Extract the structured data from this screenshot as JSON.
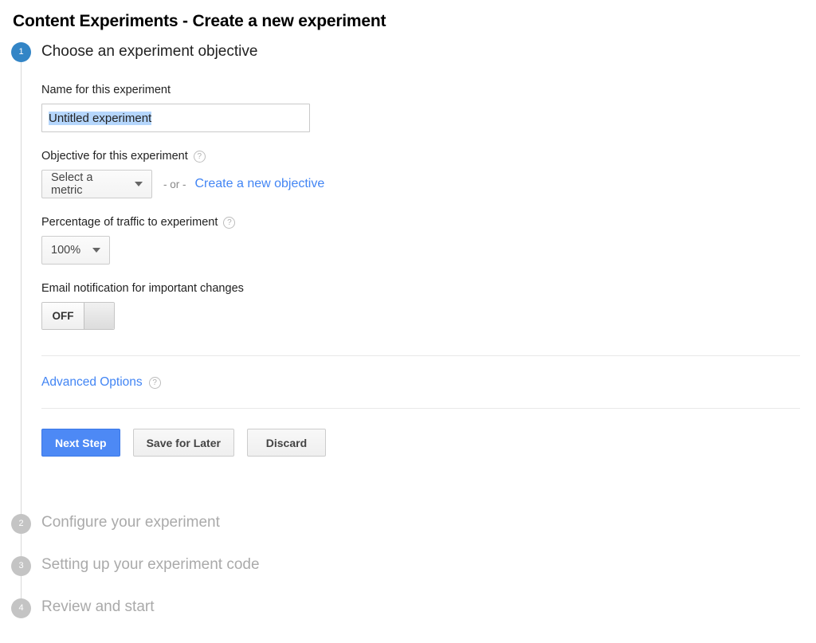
{
  "page": {
    "title": "Content Experiments - Create a new experiment"
  },
  "steps": [
    {
      "number": "1",
      "title": "Choose an experiment objective",
      "state": "active"
    },
    {
      "number": "2",
      "title": "Configure your experiment",
      "state": "inactive"
    },
    {
      "number": "3",
      "title": "Setting up your experiment code",
      "state": "inactive"
    },
    {
      "number": "4",
      "title": "Review and start",
      "state": "inactive"
    }
  ],
  "form": {
    "name_field": {
      "label": "Name for this experiment",
      "value": "Untitled experiment",
      "placeholder": "Untitled experiment"
    },
    "objective_field": {
      "label": "Objective for this experiment",
      "help_icon": "help-circle-icon",
      "dropdown_value": "Select a metric",
      "or_text": "- or -",
      "create_link": "Create a new objective"
    },
    "traffic_field": {
      "label": "Percentage of traffic to experiment",
      "help_icon": "help-circle-icon",
      "dropdown_value": "100%"
    },
    "email_field": {
      "label": "Email notification for important changes",
      "toggle_state": "OFF"
    },
    "advanced": {
      "label": "Advanced Options",
      "help_icon": "help-circle-icon"
    },
    "buttons": {
      "next": "Next Step",
      "save": "Save for Later",
      "discard": "Discard"
    }
  },
  "colors": {
    "active_step_badge": "#3385c6",
    "inactive_step_badge": "#c4c4c4",
    "primary_button": "#4d89f5",
    "link": "#4285f4",
    "selection_highlight": "#b5d6fc",
    "divider": "#e8e8e8"
  }
}
